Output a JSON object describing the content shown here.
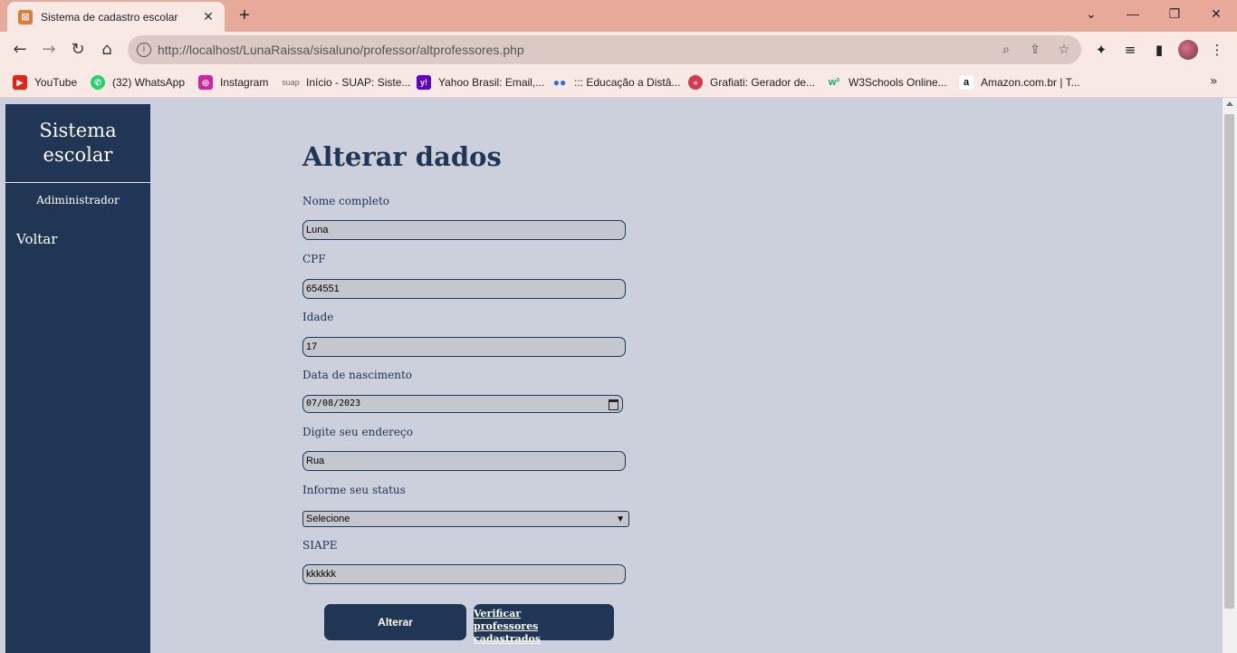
{
  "browser": {
    "tab": {
      "title": "Sistema de cadastro escolar",
      "favicon": "xampp-icon",
      "close_glyph": "✕"
    },
    "new_tab_glyph": "+",
    "window_controls": {
      "dropdown": "⌄",
      "minimize": "—",
      "restore": "❐",
      "close": "✕"
    },
    "nav": {
      "back": "←",
      "forward": "→",
      "reload": "↻",
      "home": "⌂"
    },
    "url": "http://localhost/LunaRaissa/sisaluno/professor/altprofessores.php",
    "bookmarks": [
      {
        "label": "YouTube",
        "icon": "youtube-icon",
        "color": "#e62117"
      },
      {
        "label": "(32) WhatsApp",
        "icon": "whatsapp-icon",
        "color": "#25d366"
      },
      {
        "label": "Instagram",
        "icon": "instagram-icon",
        "color": "#d6249f"
      },
      {
        "label": "Início - SUAP: Siste...",
        "icon": "suap-icon",
        "color": "#9aa0a6"
      },
      {
        "label": "Yahoo Brasil: Email,...",
        "icon": "yahoo-icon",
        "color": "#6001d2"
      },
      {
        "label": "::: Educação a Distâ...",
        "icon": "ead-icon",
        "color": "#1a73e8"
      },
      {
        "label": "Grafiati: Gerador de...",
        "icon": "grafiati-icon",
        "color": "#d9394f"
      },
      {
        "label": "W3Schools Online...",
        "icon": "w3schools-icon",
        "color": "#04aa6d"
      },
      {
        "label": "Amazon.com.br | T...",
        "icon": "amazon-icon",
        "color": "#ffffff"
      }
    ],
    "bookmarks_more": "»"
  },
  "sidebar": {
    "title_line1": "Sistema",
    "title_line2": "escolar",
    "admin": "Adiministrador",
    "back_link": "Voltar"
  },
  "form": {
    "heading": "Alterar dados",
    "nome_label": "Nome completo",
    "nome_value": "Luna",
    "cpf_label": "CPF",
    "cpf_value": "654551",
    "idade_label": "Idade",
    "idade_value": "17",
    "nasc_label": "Data de nascimento",
    "nasc_value": "07/08/2023",
    "endereco_label": "Digite seu endereço",
    "endereco_value": "Rua",
    "status_label": "Informe seu status",
    "status_value": "Selecione",
    "siape_label": "SIAPE",
    "siape_value": "kkkkkk",
    "submit_label": "Alterar",
    "verify_line1": "Verificar professores",
    "verify_line2": "cadastrados"
  },
  "colors": {
    "sidebar": "#213555",
    "page_bg": "#cbd0dc",
    "heading": "#213555",
    "tabbar": "#e6a99a"
  }
}
